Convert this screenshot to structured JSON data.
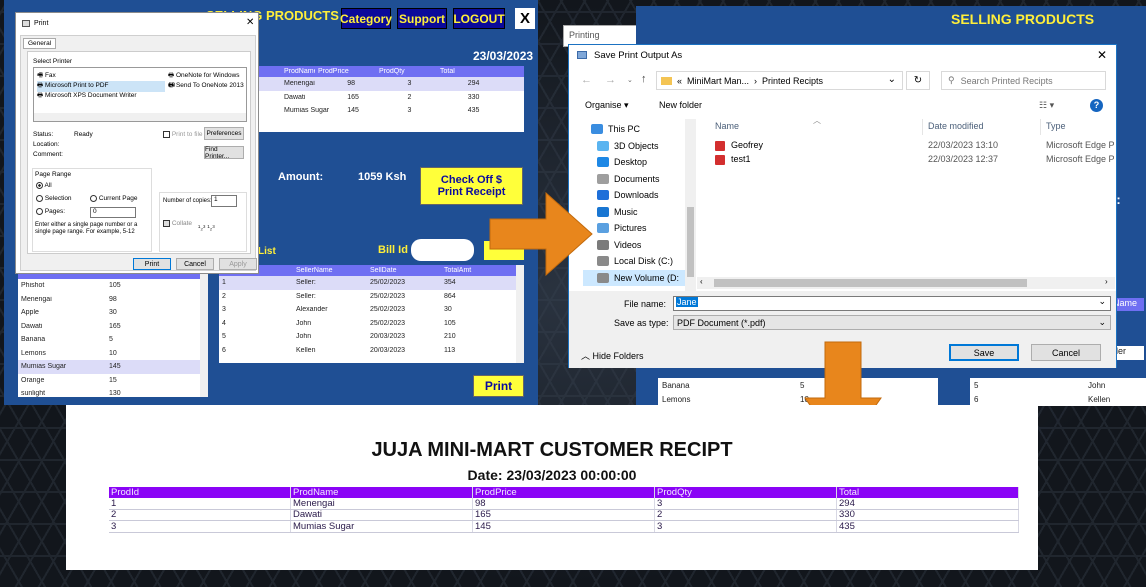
{
  "app1": {
    "title": "SELLING PRODUCTS",
    "nav": [
      "Category",
      "Support",
      "LOGOUT",
      "X"
    ],
    "date": "23/03/2023",
    "grid_headers": [
      "ProdName",
      "ProdPrice",
      "ProdQty",
      "Total"
    ],
    "grid_rows": [
      [
        "Menengai",
        "98",
        "3",
        "294"
      ],
      [
        "Dawati",
        "165",
        "2",
        "330"
      ],
      [
        "Mumias Sugar",
        "145",
        "3",
        "435"
      ]
    ],
    "amount_label": "Amount:",
    "amount_value": "1059 Ksh",
    "check_btn": "Check Off $ Print Receipt",
    "list_label": "List",
    "billid_label": "Bill Id",
    "stock_rows": [
      [
        "Phishot",
        "105"
      ],
      [
        "Menengai",
        "98"
      ],
      [
        "Apple",
        "30"
      ],
      [
        "Dawati",
        "165"
      ],
      [
        "Banana",
        "5"
      ],
      [
        "Lemons",
        "10"
      ],
      [
        "Mumias Sugar",
        "145"
      ],
      [
        "Orange",
        "15"
      ],
      [
        "sunlight",
        "130"
      ]
    ],
    "bills_headers": [
      "",
      "SellerName",
      "SellDate",
      "TotalAmt"
    ],
    "bills_rows": [
      [
        "1",
        "Seller:",
        "25/02/2023",
        "354"
      ],
      [
        "2",
        "Seller:",
        "25/02/2023",
        "864"
      ],
      [
        "3",
        "Alexander",
        "25/02/2023",
        "30"
      ],
      [
        "4",
        "John",
        "25/02/2023",
        "105"
      ],
      [
        "5",
        "John",
        "20/03/2023",
        "210"
      ],
      [
        "6",
        "Kellen",
        "20/03/2023",
        "113"
      ]
    ],
    "print_btn": "Print"
  },
  "print_dlg": {
    "title": "Print",
    "tab": "General",
    "select_printer": "Select Printer",
    "printers": [
      "Fax",
      "OneNote for Windows 10",
      "Microsoft Print to PDF",
      "Send To OneNote 2013",
      "Microsoft XPS Document Writer"
    ],
    "status_label": "Status:",
    "status_value": "Ready",
    "location_label": "Location:",
    "comment_label": "Comment:",
    "print_to_file": "Print to file",
    "preferences": "Preferences",
    "find_printer": "Find Printer...",
    "page_range": "Page Range",
    "all": "All",
    "selection": "Selection",
    "current_page": "Current Page",
    "pages": "Pages:",
    "pages_value": "0",
    "range_hint": "Enter either a single page number or a single page range.  For example, 5-12",
    "copies_label": "Number of copies:",
    "copies_value": "1",
    "collate": "Collate",
    "btn_print": "Print",
    "btn_cancel": "Cancel",
    "btn_apply": "Apply"
  },
  "app2": {
    "printing_label": "Printing",
    "title": "SELLING PRODUCTS",
    "header_fragment": "Name",
    "rows_left": [
      [
        "Banana",
        "5"
      ],
      [
        "Lemons",
        "10"
      ]
    ],
    "rows_right": [
      [
        "5",
        "John"
      ],
      [
        "6",
        "Kellen"
      ]
    ],
    "frag_ider": "der",
    "frag_colon": "t:"
  },
  "save_dlg": {
    "title": "Save Print Output As",
    "path_prefix": "«",
    "path": [
      "MiniMart Man...",
      "Printed Recipts"
    ],
    "search_placeholder": "Search Printed Recipts",
    "organise": "Organise",
    "new_folder": "New folder",
    "tree": [
      [
        "pc-icon",
        "This PC"
      ],
      [
        "objects3d-icon",
        "3D Objects"
      ],
      [
        "desktop-icon",
        "Desktop"
      ],
      [
        "documents-icon",
        "Documents"
      ],
      [
        "downloads-icon",
        "Downloads"
      ],
      [
        "music-icon",
        "Music"
      ],
      [
        "pictures-icon",
        "Pictures"
      ],
      [
        "videos-icon",
        "Videos"
      ],
      [
        "disk-icon",
        "Local Disk (C:)"
      ],
      [
        "disk-icon",
        "New Volume (D:"
      ]
    ],
    "col_name": "Name",
    "col_modified": "Date modified",
    "col_type": "Type",
    "files": [
      [
        "Geofrey",
        "22/03/2023 13:10",
        "Microsoft Edge P"
      ],
      [
        "test1",
        "22/03/2023 12:37",
        "Microsoft Edge P"
      ]
    ],
    "file_name_label": "File name:",
    "file_name_value": "Jane",
    "save_type_label": "Save as type:",
    "save_type_value": "PDF Document (*.pdf)",
    "hide_folders": "Hide Folders",
    "save": "Save",
    "cancel": "Cancel"
  },
  "receipt": {
    "title": "JUJA MINI-MART CUSTOMER RECIPT",
    "date": "Date: 23/03/2023 00:00:00",
    "headers": [
      "ProdId",
      "ProdName",
      "ProdPrice",
      "ProdQty",
      "Total"
    ],
    "rows": [
      [
        "1",
        "Menengai",
        "98",
        "3",
        "294"
      ],
      [
        "2",
        "Dawati",
        "165",
        "2",
        "330"
      ],
      [
        "3",
        "Mumias Sugar",
        "145",
        "3",
        "435"
      ]
    ]
  },
  "colors": {
    "app_blue": "#1f4f94",
    "nav_navy": "#0b0a9a",
    "yellow": "#ffff3a",
    "orange_arrow": "#e8861c",
    "receipt_header": "#8a04f6"
  }
}
